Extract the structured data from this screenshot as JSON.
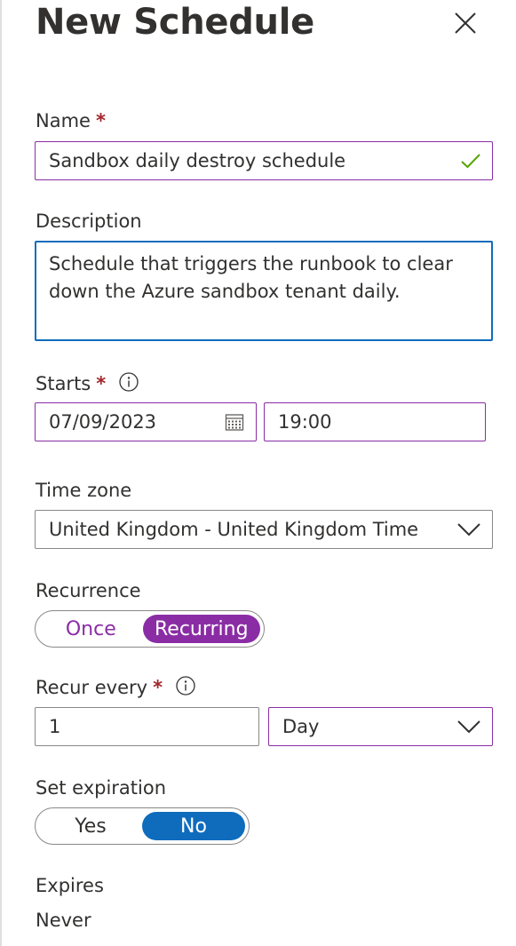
{
  "header": {
    "title": "New Schedule",
    "close_icon": "close-icon"
  },
  "name": {
    "label": "Name",
    "required": "*",
    "value": "Sandbox daily destroy schedule",
    "status_icon": "checkmark-icon"
  },
  "description": {
    "label": "Description",
    "value": "Schedule that triggers the runbook to clear down the Azure sandbox tenant daily."
  },
  "starts": {
    "label": "Starts",
    "required": "*",
    "info_icon": "info-icon",
    "date": "07/09/2023",
    "calendar_icon": "calendar-icon",
    "time": "19:00"
  },
  "time_zone": {
    "label": "Time zone",
    "value": "United Kingdom - United Kingdom Time",
    "chevron_icon": "chevron-down-icon"
  },
  "recurrence": {
    "label": "Recurrence",
    "options": [
      "Once",
      "Recurring"
    ],
    "selected": "Recurring",
    "accent": "#8a2da5"
  },
  "recur_every": {
    "label": "Recur every",
    "required": "*",
    "info_icon": "info-icon",
    "count": "1",
    "unit": "Day",
    "chevron_icon": "chevron-down-icon"
  },
  "set_expiration": {
    "label": "Set expiration",
    "options": [
      "Yes",
      "No"
    ],
    "selected": "No",
    "accent": "#0f6cbd"
  },
  "expires": {
    "label": "Expires",
    "value": "Never"
  }
}
